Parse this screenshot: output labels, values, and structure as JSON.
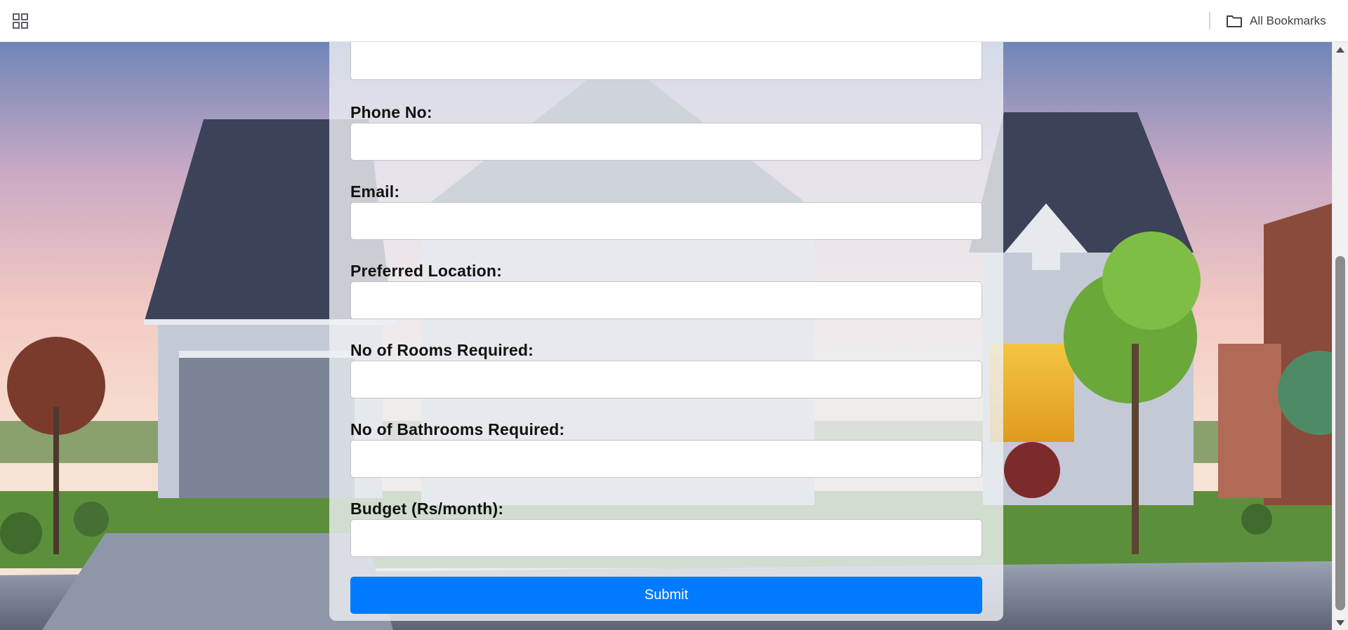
{
  "bookmarks_bar": {
    "apps_icon": "apps-grid-icon",
    "all_bookmarks_label": "All Bookmarks",
    "folder_icon": "folder-icon"
  },
  "form": {
    "fields": [
      {
        "label": "Phone No:",
        "value": ""
      },
      {
        "label": "Email:",
        "value": ""
      },
      {
        "label": "Preferred Location:",
        "value": ""
      },
      {
        "label": "No of Rooms Required:",
        "value": ""
      },
      {
        "label": "No of Bathrooms Required:",
        "value": ""
      },
      {
        "label": "Budget (Rs/month):",
        "value": ""
      }
    ],
    "submit_label": "Submit"
  },
  "colors": {
    "submit_button": "#007bff",
    "panel": "#eef0f4",
    "sky_top": "#6f86b8",
    "sky_horizon": "#f3c9c2",
    "roof": "#3c4258",
    "siding": "#c3cad6"
  }
}
